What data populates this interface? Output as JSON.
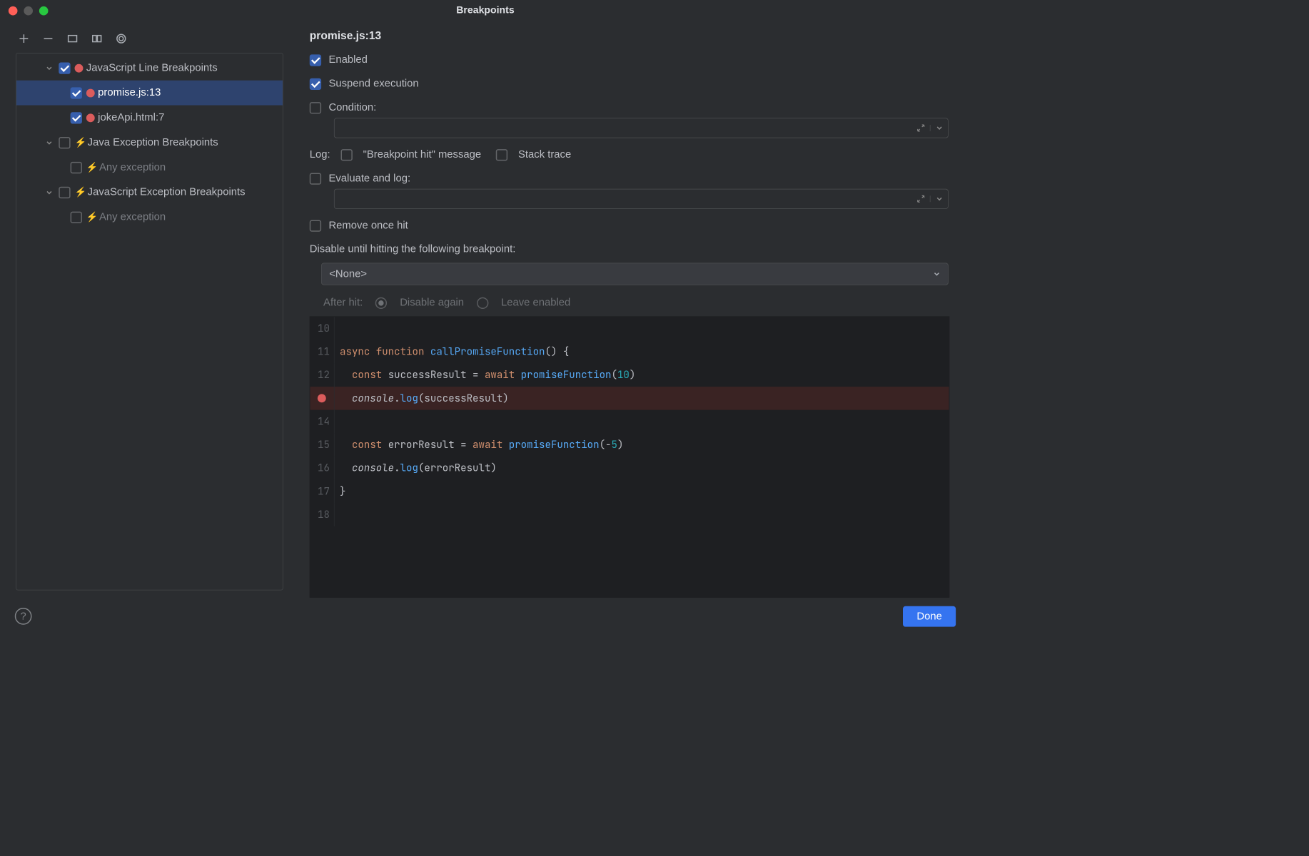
{
  "title": "Breakpoints",
  "tree": {
    "jsLine": {
      "label": "JavaScript Line Breakpoints",
      "checked": true,
      "items": [
        {
          "label": "promise.js:13",
          "checked": true,
          "selected": true
        },
        {
          "label": "jokeApi.html:7",
          "checked": true,
          "selected": false
        }
      ]
    },
    "javaExc": {
      "label": "Java Exception Breakpoints",
      "checked": false,
      "items": [
        {
          "label": "Any exception",
          "checked": false
        }
      ]
    },
    "jsExc": {
      "label": "JavaScript Exception Breakpoints",
      "checked": false,
      "items": [
        {
          "label": "Any exception",
          "checked": false
        }
      ]
    }
  },
  "details": {
    "header": "promise.js:13",
    "enabled": {
      "label": "Enabled",
      "checked": true
    },
    "suspend": {
      "label": "Suspend execution",
      "checked": true
    },
    "condition": {
      "label": "Condition:",
      "checked": false,
      "value": ""
    },
    "logLabel": "Log:",
    "logHit": {
      "label": "\"Breakpoint hit\" message",
      "checked": false
    },
    "logStack": {
      "label": "Stack trace",
      "checked": false
    },
    "evalLog": {
      "label": "Evaluate and log:",
      "checked": false,
      "value": ""
    },
    "removeOnce": {
      "label": "Remove once hit",
      "checked": false
    },
    "disableUntilLabel": "Disable until hitting the following breakpoint:",
    "disableUntilValue": "<None>",
    "afterHitLabel": "After hit:",
    "afterHit": {
      "disable": "Disable again",
      "leave": "Leave enabled",
      "selected": "disable"
    }
  },
  "code": [
    {
      "n": "10",
      "html": ""
    },
    {
      "n": "11",
      "html": "<span class='kw'>async</span> <span class='kw'>function</span> <span class='fn'>callPromiseFunction</span>() {"
    },
    {
      "n": "12",
      "html": "  <span class='kw'>const</span> successResult = <span class='kw'>await</span> <span class='call'>promiseFunction</span>(<span class='num'>10</span>)"
    },
    {
      "n": "",
      "bp": true,
      "html": "  <span class='it'>console</span>.<span class='call'>log</span>(successResult)"
    },
    {
      "n": "14",
      "html": ""
    },
    {
      "n": "15",
      "html": "  <span class='kw'>const</span> errorResult = <span class='kw'>await</span> <span class='call'>promiseFunction</span>(-<span class='num'>5</span>)"
    },
    {
      "n": "16",
      "html": "  <span class='it'>console</span>.<span class='call'>log</span>(errorResult)"
    },
    {
      "n": "17",
      "html": "}"
    },
    {
      "n": "18",
      "html": ""
    }
  ],
  "footer": {
    "done": "Done"
  }
}
